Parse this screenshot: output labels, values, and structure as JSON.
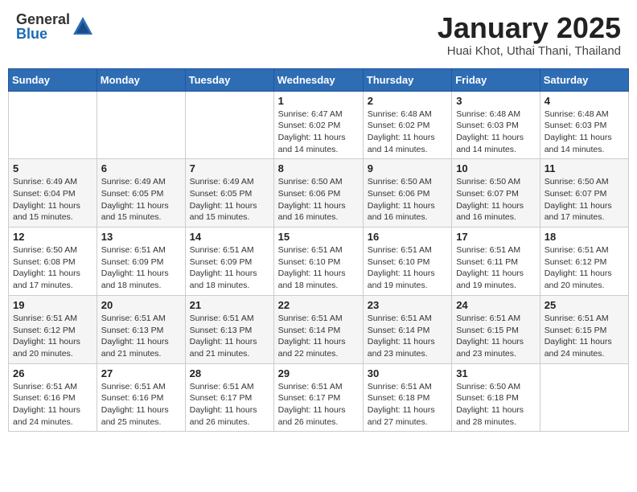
{
  "logo": {
    "general": "General",
    "blue": "Blue"
  },
  "header": {
    "month": "January 2025",
    "location": "Huai Khot, Uthai Thani, Thailand"
  },
  "weekdays": [
    "Sunday",
    "Monday",
    "Tuesday",
    "Wednesday",
    "Thursday",
    "Friday",
    "Saturday"
  ],
  "weeks": [
    [
      {
        "day": "",
        "sunrise": "",
        "sunset": "",
        "daylight": ""
      },
      {
        "day": "",
        "sunrise": "",
        "sunset": "",
        "daylight": ""
      },
      {
        "day": "",
        "sunrise": "",
        "sunset": "",
        "daylight": ""
      },
      {
        "day": "1",
        "sunrise": "Sunrise: 6:47 AM",
        "sunset": "Sunset: 6:02 PM",
        "daylight": "Daylight: 11 hours and 14 minutes."
      },
      {
        "day": "2",
        "sunrise": "Sunrise: 6:48 AM",
        "sunset": "Sunset: 6:02 PM",
        "daylight": "Daylight: 11 hours and 14 minutes."
      },
      {
        "day": "3",
        "sunrise": "Sunrise: 6:48 AM",
        "sunset": "Sunset: 6:03 PM",
        "daylight": "Daylight: 11 hours and 14 minutes."
      },
      {
        "day": "4",
        "sunrise": "Sunrise: 6:48 AM",
        "sunset": "Sunset: 6:03 PM",
        "daylight": "Daylight: 11 hours and 14 minutes."
      }
    ],
    [
      {
        "day": "5",
        "sunrise": "Sunrise: 6:49 AM",
        "sunset": "Sunset: 6:04 PM",
        "daylight": "Daylight: 11 hours and 15 minutes."
      },
      {
        "day": "6",
        "sunrise": "Sunrise: 6:49 AM",
        "sunset": "Sunset: 6:05 PM",
        "daylight": "Daylight: 11 hours and 15 minutes."
      },
      {
        "day": "7",
        "sunrise": "Sunrise: 6:49 AM",
        "sunset": "Sunset: 6:05 PM",
        "daylight": "Daylight: 11 hours and 15 minutes."
      },
      {
        "day": "8",
        "sunrise": "Sunrise: 6:50 AM",
        "sunset": "Sunset: 6:06 PM",
        "daylight": "Daylight: 11 hours and 16 minutes."
      },
      {
        "day": "9",
        "sunrise": "Sunrise: 6:50 AM",
        "sunset": "Sunset: 6:06 PM",
        "daylight": "Daylight: 11 hours and 16 minutes."
      },
      {
        "day": "10",
        "sunrise": "Sunrise: 6:50 AM",
        "sunset": "Sunset: 6:07 PM",
        "daylight": "Daylight: 11 hours and 16 minutes."
      },
      {
        "day": "11",
        "sunrise": "Sunrise: 6:50 AM",
        "sunset": "Sunset: 6:07 PM",
        "daylight": "Daylight: 11 hours and 17 minutes."
      }
    ],
    [
      {
        "day": "12",
        "sunrise": "Sunrise: 6:50 AM",
        "sunset": "Sunset: 6:08 PM",
        "daylight": "Daylight: 11 hours and 17 minutes."
      },
      {
        "day": "13",
        "sunrise": "Sunrise: 6:51 AM",
        "sunset": "Sunset: 6:09 PM",
        "daylight": "Daylight: 11 hours and 18 minutes."
      },
      {
        "day": "14",
        "sunrise": "Sunrise: 6:51 AM",
        "sunset": "Sunset: 6:09 PM",
        "daylight": "Daylight: 11 hours and 18 minutes."
      },
      {
        "day": "15",
        "sunrise": "Sunrise: 6:51 AM",
        "sunset": "Sunset: 6:10 PM",
        "daylight": "Daylight: 11 hours and 18 minutes."
      },
      {
        "day": "16",
        "sunrise": "Sunrise: 6:51 AM",
        "sunset": "Sunset: 6:10 PM",
        "daylight": "Daylight: 11 hours and 19 minutes."
      },
      {
        "day": "17",
        "sunrise": "Sunrise: 6:51 AM",
        "sunset": "Sunset: 6:11 PM",
        "daylight": "Daylight: 11 hours and 19 minutes."
      },
      {
        "day": "18",
        "sunrise": "Sunrise: 6:51 AM",
        "sunset": "Sunset: 6:12 PM",
        "daylight": "Daylight: 11 hours and 20 minutes."
      }
    ],
    [
      {
        "day": "19",
        "sunrise": "Sunrise: 6:51 AM",
        "sunset": "Sunset: 6:12 PM",
        "daylight": "Daylight: 11 hours and 20 minutes."
      },
      {
        "day": "20",
        "sunrise": "Sunrise: 6:51 AM",
        "sunset": "Sunset: 6:13 PM",
        "daylight": "Daylight: 11 hours and 21 minutes."
      },
      {
        "day": "21",
        "sunrise": "Sunrise: 6:51 AM",
        "sunset": "Sunset: 6:13 PM",
        "daylight": "Daylight: 11 hours and 21 minutes."
      },
      {
        "day": "22",
        "sunrise": "Sunrise: 6:51 AM",
        "sunset": "Sunset: 6:14 PM",
        "daylight": "Daylight: 11 hours and 22 minutes."
      },
      {
        "day": "23",
        "sunrise": "Sunrise: 6:51 AM",
        "sunset": "Sunset: 6:14 PM",
        "daylight": "Daylight: 11 hours and 23 minutes."
      },
      {
        "day": "24",
        "sunrise": "Sunrise: 6:51 AM",
        "sunset": "Sunset: 6:15 PM",
        "daylight": "Daylight: 11 hours and 23 minutes."
      },
      {
        "day": "25",
        "sunrise": "Sunrise: 6:51 AM",
        "sunset": "Sunset: 6:15 PM",
        "daylight": "Daylight: 11 hours and 24 minutes."
      }
    ],
    [
      {
        "day": "26",
        "sunrise": "Sunrise: 6:51 AM",
        "sunset": "Sunset: 6:16 PM",
        "daylight": "Daylight: 11 hours and 24 minutes."
      },
      {
        "day": "27",
        "sunrise": "Sunrise: 6:51 AM",
        "sunset": "Sunset: 6:16 PM",
        "daylight": "Daylight: 11 hours and 25 minutes."
      },
      {
        "day": "28",
        "sunrise": "Sunrise: 6:51 AM",
        "sunset": "Sunset: 6:17 PM",
        "daylight": "Daylight: 11 hours and 26 minutes."
      },
      {
        "day": "29",
        "sunrise": "Sunrise: 6:51 AM",
        "sunset": "Sunset: 6:17 PM",
        "daylight": "Daylight: 11 hours and 26 minutes."
      },
      {
        "day": "30",
        "sunrise": "Sunrise: 6:51 AM",
        "sunset": "Sunset: 6:18 PM",
        "daylight": "Daylight: 11 hours and 27 minutes."
      },
      {
        "day": "31",
        "sunrise": "Sunrise: 6:50 AM",
        "sunset": "Sunset: 6:18 PM",
        "daylight": "Daylight: 11 hours and 28 minutes."
      },
      {
        "day": "",
        "sunrise": "",
        "sunset": "",
        "daylight": ""
      }
    ]
  ]
}
